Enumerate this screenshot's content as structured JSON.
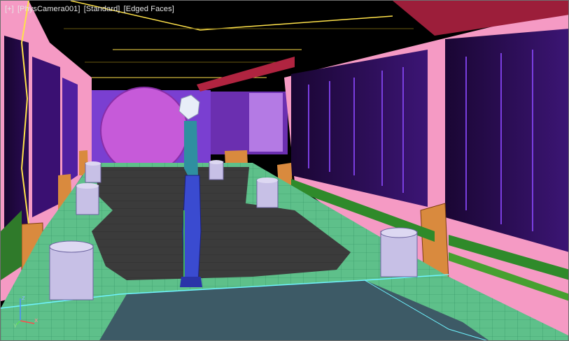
{
  "viewport": {
    "label_menu": "[+]",
    "label_camera": "[PhysCamera001]",
    "label_shading": "[Standard]",
    "label_display": "[Edged Faces]"
  },
  "axis_tripod": {
    "x_label": "x",
    "y_label": "y",
    "z_label": "z"
  },
  "colors": {
    "background": "#000000",
    "wall_pink": "#f59ac4",
    "panel_purple": "#4a1a86",
    "floor_green": "#5ec08a",
    "floor_dark": "#3b3b3b",
    "portal_magenta": "#c65ad9",
    "barrel_lavender": "#c7c0e6",
    "pillar_orange": "#d98a3e",
    "selection_yellow": "#ffe24a",
    "selection_cyan": "#6ff4ff",
    "character_blue": "#3a4bd0"
  }
}
